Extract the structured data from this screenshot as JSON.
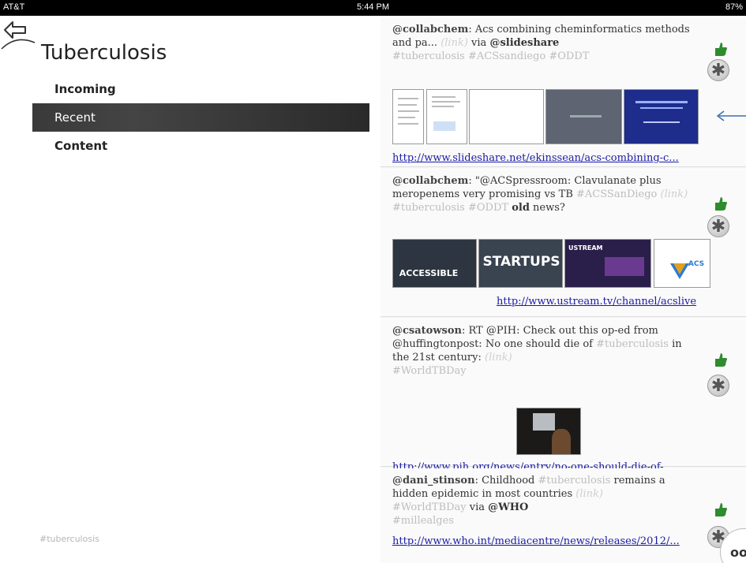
{
  "status_bar": {
    "carrier": "AT&T",
    "time": "5:44 PM",
    "battery": "87%"
  },
  "sidebar": {
    "title": "Tuberculosis",
    "items": [
      {
        "label": "Incoming",
        "active": false
      },
      {
        "label": "Recent",
        "active": true
      },
      {
        "label": "Content",
        "active": false
      }
    ],
    "footer_tag": "#tuberculosis"
  },
  "posts": [
    {
      "user": "@collabchem",
      "text_a": ": Acs combining cheminformatics methods and pa... ",
      "link_placeholder": "(link)",
      "text_b": " via ",
      "strong": "@slideshare",
      "tags": "#tuberculosis #ACSsandiego #ODDT",
      "url": "http://www.slideshare.net/ekinssean/acs-combining-c..."
    },
    {
      "user": "@collabchem",
      "text_a": ": \"@ACSpressroom: Clavulanate plus meropenems very promising vs TB ",
      "tag_a": "#ACSSanDiego",
      "link_placeholder": "(link)",
      "tag_b": "#tuberculosis #ODDT",
      "strong": "old",
      "text_b": "news?",
      "thumb_labels": [
        "ACCESSIBLE",
        "STARTUPS",
        "USTREAM",
        "ACS"
      ],
      "url": "http://www.ustream.tv/channel/acslive"
    },
    {
      "user": "@csatowson",
      "text_a": ": RT @PIH: Check out this op-ed from @huffingtonpost: No one should die of ",
      "tag_a": "#tuberculosis",
      "text_b": " in the 21st century: ",
      "link_placeholder": "(link)",
      "tag_b": "#WorldTBDay",
      "url": "http://www.pih.org/news/entry/no-one-should-die-of-..."
    },
    {
      "user": "@dani_stinson",
      "text_a": ": Childhood ",
      "tag_a": "#tuberculosis",
      "text_b": " remains a hidden epidemic in most countries ",
      "link_placeholder": "(link)",
      "tag_b": "#WorldTBDay",
      "text_c": " via ",
      "strong": "@WHO",
      "tag_c": "#millealges",
      "url": "http://www.who.int/mediacentre/news/releases/2012/..."
    }
  ],
  "corner_button": {
    "label": "oo"
  },
  "colors": {
    "accent_green": "#2e8b2e",
    "link_blue": "#1a1aa6",
    "nav_active": "#3a3a3a"
  }
}
